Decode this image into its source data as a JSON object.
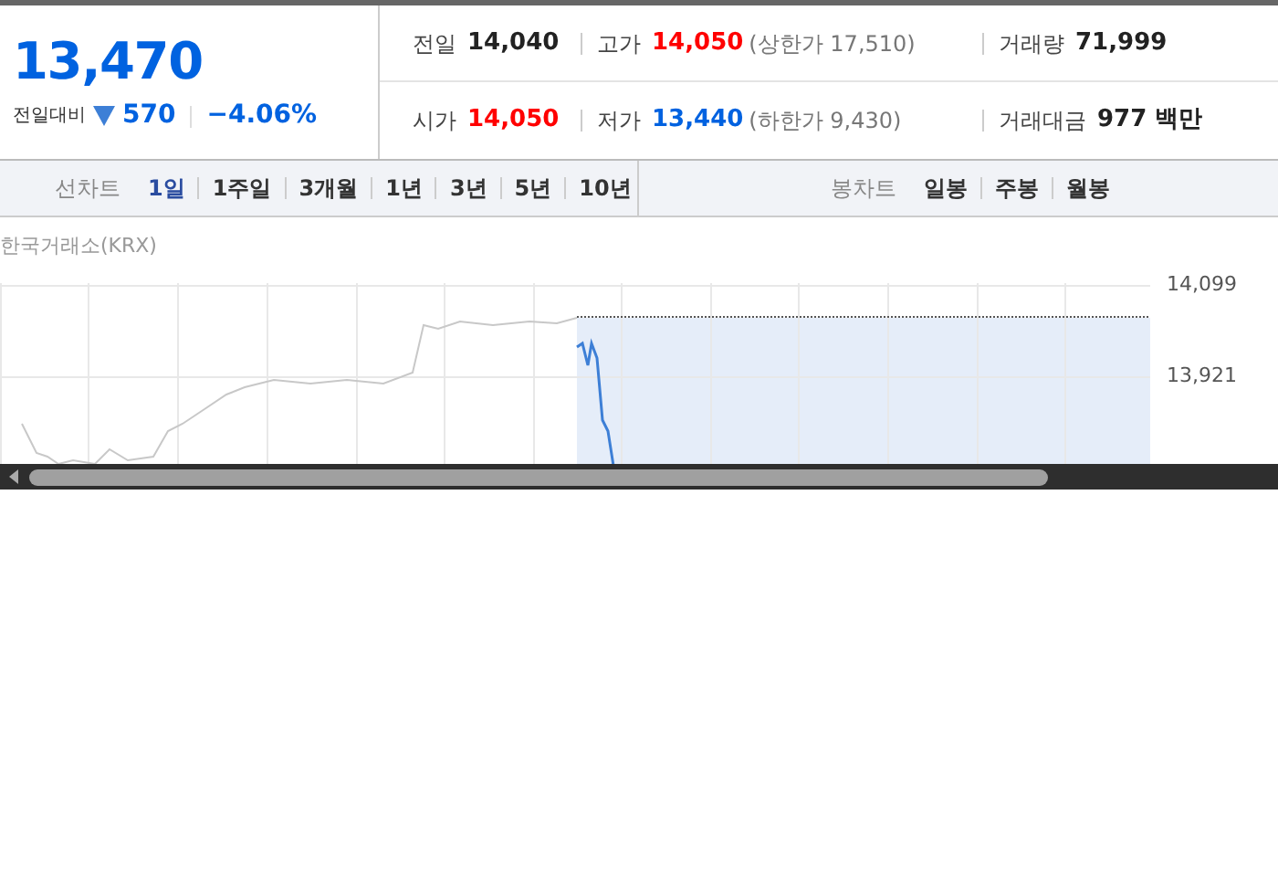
{
  "price": {
    "current": "13,470",
    "change_label": "전일대비",
    "change": "570",
    "falling": true,
    "change_rate": "−4.06%"
  },
  "stats": [
    {
      "label": "전일",
      "value": "14,040",
      "color": "#222222"
    },
    {
      "label": "고가",
      "value": "14,050",
      "color": "#ff0000",
      "limit": "(상한가 17,510)"
    },
    {
      "label": "거래량",
      "value": "71,999",
      "color": "#222222"
    },
    {
      "label": "시가",
      "value": "14,050",
      "color": "#ff0000"
    },
    {
      "label": "저가",
      "value": "13,440",
      "color": "#0062e0",
      "limit": "(하한가 9,430)"
    },
    {
      "label": "거래대금",
      "value": "977 백만",
      "color": "#222222"
    }
  ],
  "line_chart_tabs": {
    "title": "선차트",
    "items": [
      {
        "label": "1일",
        "selected": true
      },
      {
        "label": "1주일",
        "selected": false
      },
      {
        "label": "3개월",
        "selected": false
      },
      {
        "label": "1년",
        "selected": false
      },
      {
        "label": "3년",
        "selected": false
      },
      {
        "label": "5년",
        "selected": false
      },
      {
        "label": "10년",
        "selected": false
      }
    ]
  },
  "candle_chart_tabs": {
    "title": "봉차트",
    "items": [
      {
        "label": "일봉",
        "selected": false
      },
      {
        "label": "주봉",
        "selected": false
      },
      {
        "label": "월봉",
        "selected": false
      }
    ]
  },
  "chart": {
    "source": "한국거래소(KRX)",
    "y_tick_labels": [
      "14,099",
      "13,921"
    ]
  }
}
